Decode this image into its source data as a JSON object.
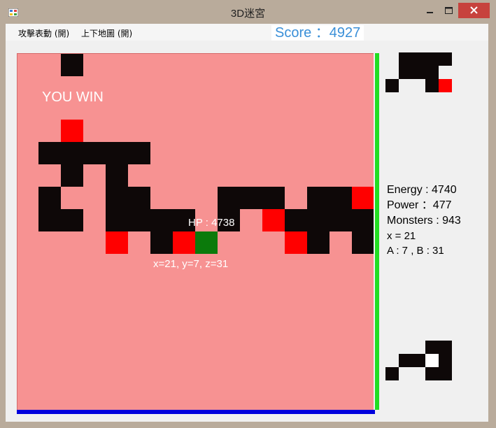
{
  "window": {
    "title": "3D迷宮"
  },
  "menu": {
    "items": [
      "攻擊表動 (開)",
      "上下地圖 (開)"
    ]
  },
  "score": {
    "text": "Score ：4927"
  },
  "game": {
    "status_text": "YOU WIN",
    "hp_text": "HP : 4738",
    "coord_text": "x=21, y=7, z=31"
  },
  "stats": {
    "energy": "Energy : 4740",
    "power": "Power ：477",
    "monsters": "Monsters : 943",
    "x": "x = 21",
    "ab": "A : 7 , B : 31"
  },
  "colors": {
    "floor": "#f79292",
    "wall": "#0e0808",
    "enemy": "#ff0000",
    "player": "#0b7a0b",
    "energy_bar": "#22dd22",
    "hp_bar": "#0000dd",
    "score_text": "#3a8fd8"
  }
}
